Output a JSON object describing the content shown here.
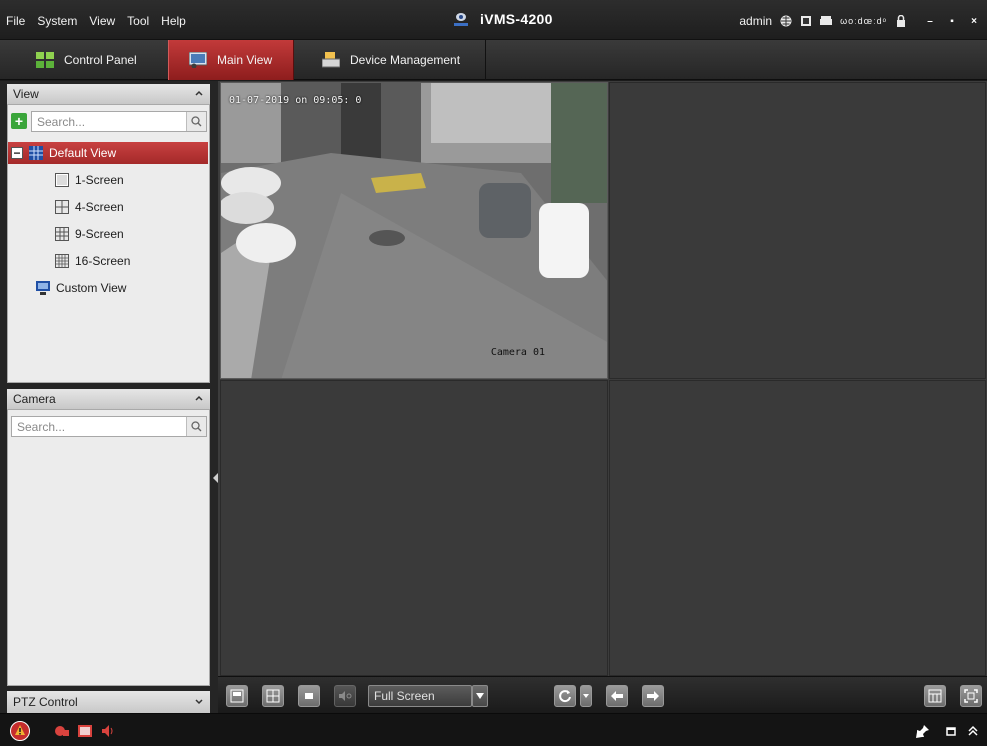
{
  "menu": [
    "File",
    "System",
    "View",
    "Tool",
    "Help"
  ],
  "app_title": "iVMS-4200",
  "user": "admin",
  "clock_text": "ωοːdœːdᵒ",
  "tabs": {
    "control_panel": "Control Panel",
    "main_view": "Main View",
    "device_management": "Device Management"
  },
  "view_panel": {
    "title": "View",
    "search_placeholder": "Search...",
    "items": [
      {
        "label": "Default View",
        "icon": "view-group-icon",
        "selected": true
      },
      {
        "label": "1-Screen",
        "icon": "one-screen-icon"
      },
      {
        "label": "4-Screen",
        "icon": "four-screen-icon"
      },
      {
        "label": "9-Screen",
        "icon": "nine-screen-icon"
      },
      {
        "label": "16-Screen",
        "icon": "sixteen-screen-icon"
      },
      {
        "label": "Custom View",
        "icon": "custom-view-icon"
      }
    ]
  },
  "camera_panel": {
    "title": "Camera",
    "search_placeholder": "Search..."
  },
  "ptz": {
    "title": "PTZ Control"
  },
  "video": {
    "timestamp": "01-07-2019  on 09:05: 0",
    "camera_name": "Camera 01"
  },
  "toolbar": {
    "fullscreen_label": "Full Screen"
  },
  "colors": {
    "accent_red": "#b52f2f",
    "panel_bg": "#ececec",
    "video_bg": "#3a3a3a"
  }
}
